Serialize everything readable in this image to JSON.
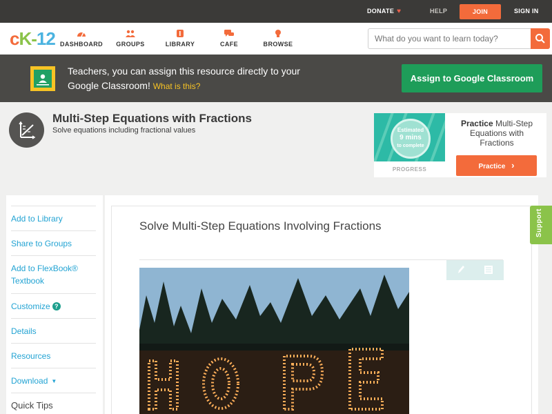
{
  "topbar": {
    "donate": "DONATE",
    "help": "HELP",
    "join": "JOIN",
    "signin": "SIGN IN"
  },
  "logo": {
    "c": "c",
    "k": "K",
    "dash": "-",
    "n": "12"
  },
  "nav": {
    "dashboard": "DASHBOARD",
    "groups": "GROUPS",
    "library": "LIBRARY",
    "cafe": "CAFE",
    "browse": "BROWSE"
  },
  "search": {
    "placeholder": "What do you want to learn today?"
  },
  "classroom_banner": {
    "text": "Teachers, you can assign this resource directly to your Google Classroom!",
    "what_link": "What is this?",
    "button": "Assign to Google Classroom"
  },
  "concept": {
    "title": "Multi-Step Equations with Fractions",
    "subtitle": "Solve equations including fractional values"
  },
  "practice_card": {
    "estimated": "Estimated",
    "mins": "9 mins",
    "to_complete": "to complete",
    "progress_label": "PROGRESS",
    "title_bold": "Practice",
    "title_rest": "Multi-Step Equations with Fractions",
    "button": "Practice"
  },
  "sidebar": {
    "items": [
      "Add to Library",
      "Share to Groups",
      "Add to FlexBook® Textbook",
      "Customize",
      "Details",
      "Resources",
      "Download"
    ],
    "quick_tips": "Quick Tips"
  },
  "lesson": {
    "title": "Solve Multi-Step Equations Involving Fractions",
    "image_letters": [
      "H",
      "O",
      "P",
      "E"
    ]
  },
  "support": "Support",
  "colors": {
    "orange": "#f36b3b",
    "green": "#1e9d59",
    "link": "#22a3d3",
    "teal": "#2dbaa6"
  }
}
